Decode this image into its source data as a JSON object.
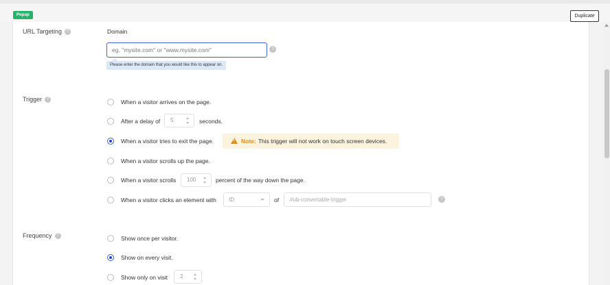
{
  "header": {
    "badge": "Popup",
    "duplicate_label": "Duplicate"
  },
  "url_targeting": {
    "label": "URL Targeting",
    "domain_label": "Domain",
    "placeholder": "eg. \"mysite.com\" or \"www.mysite.com\"",
    "value": "",
    "tooltip": "Please enter the domain that you would like this to appear on."
  },
  "trigger": {
    "label": "Trigger",
    "options": [
      {
        "label": "When a visitor arrives on the page.",
        "checked": false
      },
      {
        "label_before": "After a delay of",
        "value": "5",
        "label_after": "seconds.",
        "checked": false
      },
      {
        "label": "When a visitor tries to exit the page.",
        "checked": true
      },
      {
        "label": "When a visitor scrolls up the page.",
        "checked": false
      },
      {
        "label_before": "When a visitor scrolls",
        "value": "100",
        "label_after": "percent of the way down the page.",
        "checked": false
      },
      {
        "label": "When a visitor clicks an element with",
        "select_value": "ID",
        "of_label": "of",
        "input_placeholder": "#ub-convertable-trigger",
        "checked": false
      }
    ],
    "note": {
      "label": "Note:",
      "text": "This trigger will not work on touch screen devices."
    }
  },
  "frequency": {
    "label": "Frequency",
    "options": [
      {
        "label": "Show once per visitor.",
        "checked": false
      },
      {
        "label": "Show on every visit.",
        "checked": true
      },
      {
        "label": "Show only on visit",
        "value": "2",
        "checked": false
      }
    ]
  },
  "icons": {
    "help": "help-icon",
    "warning": "warning-icon"
  },
  "colors": {
    "accent": "#2741c9",
    "badge": "#27b26b",
    "warning": "#e8890c",
    "note_bg": "#fbf3dd",
    "tooltip_bg": "#dbe8f7"
  }
}
